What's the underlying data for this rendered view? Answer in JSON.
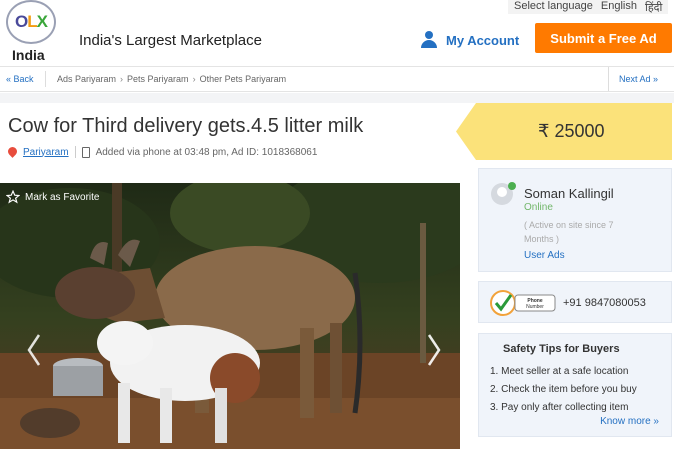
{
  "header": {
    "logo_country": "India",
    "tagline": "India's Largest Marketplace",
    "language_label": "Select language",
    "language_current": "English",
    "language_alt": "हिंदी",
    "account_label": "My Account",
    "submit_label": "Submit a Free Ad"
  },
  "breadcrumb": {
    "back": "« Back",
    "items": [
      "Ads Pariyaram",
      "Pets Pariyaram",
      "Other Pets Pariyaram"
    ],
    "next": "Next Ad »"
  },
  "ad": {
    "title": "Cow for Third delivery gets.4.5 litter milk",
    "location": "Pariyaram",
    "meta": "Added via phone at 03:48 pm, Ad ID: 1018368061",
    "price": "₹ 25000",
    "favorite_label": "Mark as Favorite"
  },
  "seller": {
    "name": "Soman Kallingil",
    "status": "Online",
    "since": "( Active on site since 7 Months )",
    "user_ads": "User Ads",
    "phone": "+91 9847080053",
    "badge_text": "Phone Number verified"
  },
  "tips": {
    "title": "Safety Tips for Buyers",
    "items": [
      "1. Meet seller at a safe location",
      "2. Check the item before you buy",
      "3. Pay only after collecting item"
    ],
    "know_more": "Know more »"
  },
  "colors": {
    "accent_blue": "#2470c2",
    "submit_orange": "#ff7a00",
    "price_yellow": "#fbe27a",
    "online_green": "#4caf50"
  }
}
